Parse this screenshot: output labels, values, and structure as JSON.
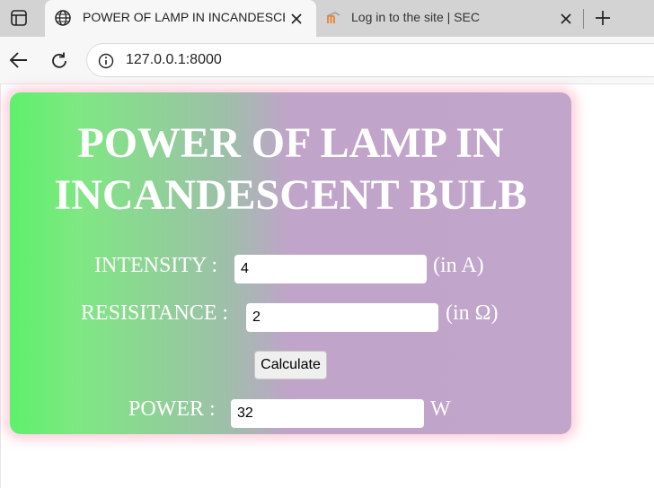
{
  "browser": {
    "tabs": [
      {
        "title": "POWER OF LAMP IN INCANDESCENT BULB",
        "active": true
      },
      {
        "title": "Log in to the site | SEC",
        "active": false
      }
    ],
    "address": "127.0.0.1:8000"
  },
  "page": {
    "title_line1": "POWER OF LAMP IN",
    "title_line2": "INCANDESCENT BULB",
    "intensity": {
      "label": "INTENSITY :",
      "value": "4",
      "unit": "(in A)"
    },
    "resistance": {
      "label": "RESISITANCE :",
      "value": "2",
      "unit": "(in Ω)"
    },
    "calculate_label": "Calculate",
    "power": {
      "label": "POWER :",
      "value": "32",
      "unit": "W"
    },
    "colors": {
      "gradient_start": "#5ef06c",
      "gradient_end": "#c1a5ca",
      "glow": "#ffaabe"
    }
  }
}
